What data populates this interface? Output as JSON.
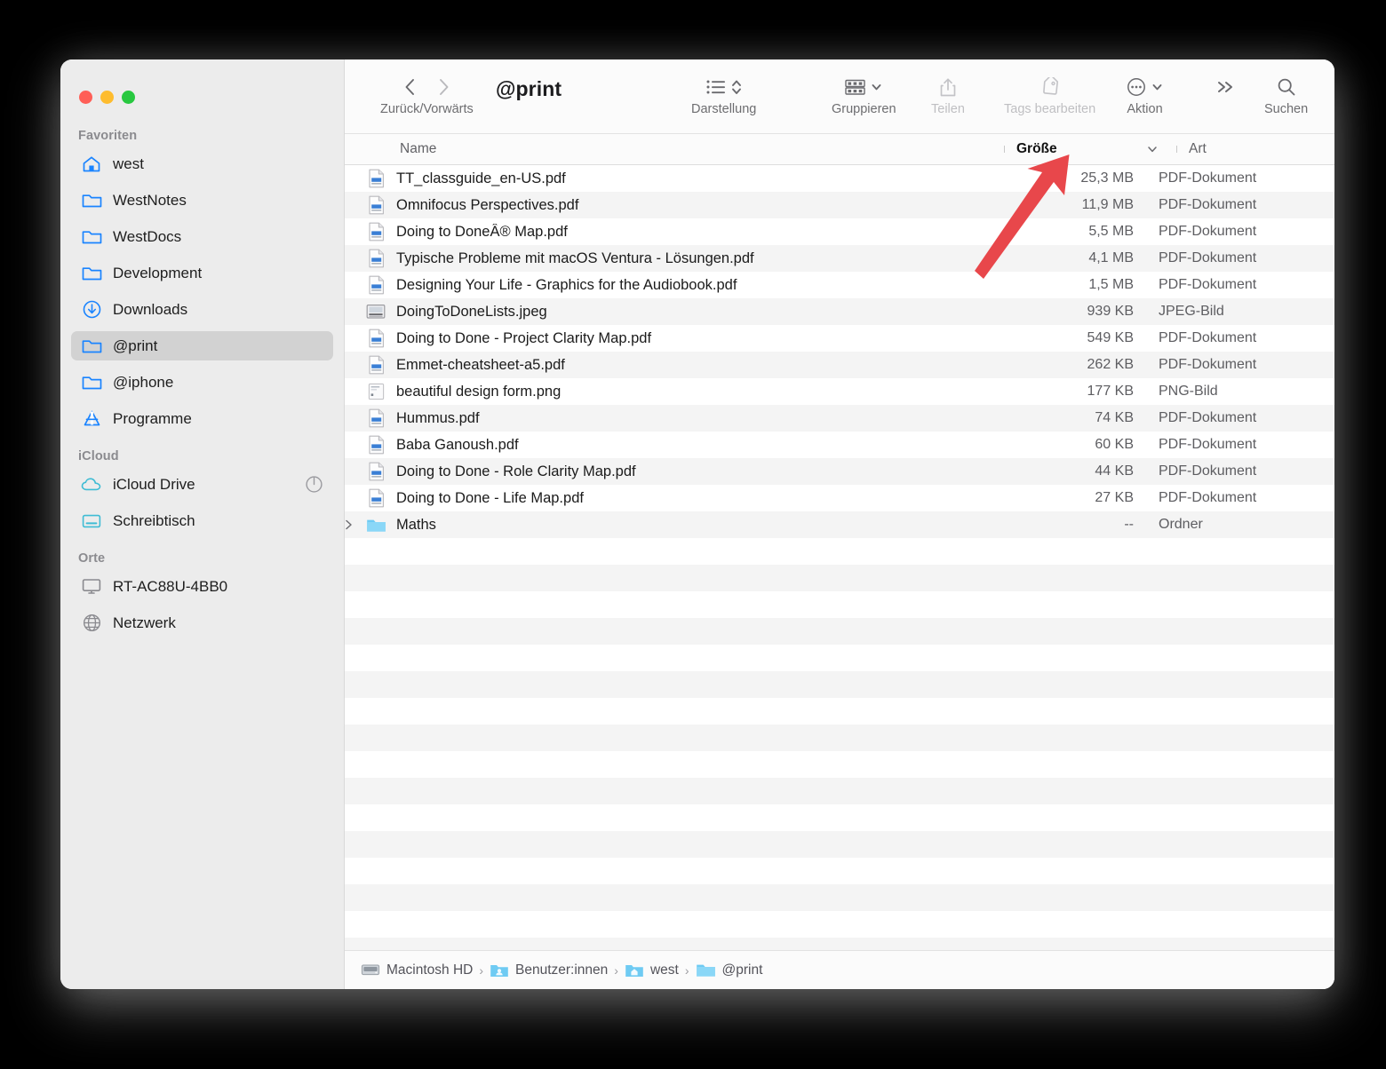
{
  "window": {
    "title": "@print",
    "traffic_lights": [
      "close",
      "minimize",
      "zoom"
    ]
  },
  "toolbar": {
    "nav_label": "Zurück/Vorwärts",
    "back_icon": "chevron-left-icon",
    "forward_icon": "chevron-right-icon",
    "title": "@print",
    "items": [
      {
        "label": "Darstellung",
        "icon": "list-view-icon",
        "enabled": true,
        "has_chevron": true
      },
      {
        "label": "Gruppieren",
        "icon": "group-icon",
        "enabled": true,
        "has_chevron": true
      },
      {
        "label": "Teilen",
        "icon": "share-icon",
        "enabled": false,
        "has_chevron": false
      },
      {
        "label": "Tags bearbeiten",
        "icon": "tag-icon",
        "enabled": false,
        "has_chevron": false
      },
      {
        "label": "Aktion",
        "icon": "more-circle-icon",
        "enabled": true,
        "has_chevron": true
      },
      {
        "label": "",
        "icon": "chevrons-right-icon",
        "enabled": true,
        "has_chevron": false
      },
      {
        "label": "Suchen",
        "icon": "search-icon",
        "enabled": true,
        "has_chevron": false
      }
    ]
  },
  "sidebar": {
    "groups": [
      {
        "title": "Favoriten",
        "items": [
          {
            "label": "west",
            "icon": "home-icon",
            "selected": false
          },
          {
            "label": "WestNotes",
            "icon": "folder-icon",
            "selected": false
          },
          {
            "label": "WestDocs",
            "icon": "folder-icon",
            "selected": false
          },
          {
            "label": "Development",
            "icon": "folder-icon",
            "selected": false
          },
          {
            "label": "Downloads",
            "icon": "download-circle-icon",
            "selected": false
          },
          {
            "label": "@print",
            "icon": "folder-icon",
            "selected": true
          },
          {
            "label": "@iphone",
            "icon": "folder-icon",
            "selected": false
          },
          {
            "label": "Programme",
            "icon": "applications-icon",
            "selected": false
          }
        ]
      },
      {
        "title": "iCloud",
        "items": [
          {
            "label": "iCloud Drive",
            "icon": "cloud-icon",
            "selected": false,
            "status_icon": "sync-progress-icon"
          },
          {
            "label": "Schreibtisch",
            "icon": "desktop-icon",
            "selected": false
          }
        ]
      },
      {
        "title": "Orte",
        "items": [
          {
            "label": "RT-AC88U-4BB0",
            "icon": "display-icon",
            "selected": false
          },
          {
            "label": "Netzwerk",
            "icon": "globe-icon",
            "selected": false
          }
        ]
      }
    ]
  },
  "columns": {
    "name": "Name",
    "size": "Größe",
    "kind": "Art",
    "sorted_by": "Größe",
    "sort_direction": "descending",
    "sort_icon": "chevron-down-icon"
  },
  "files": [
    {
      "name": "TT_classguide_en-US.pdf",
      "size": "25,3 MB",
      "kind": "PDF-Dokument",
      "icon": "pdf-file-icon",
      "is_folder": false
    },
    {
      "name": "Omnifocus Perspectives.pdf",
      "size": "11,9 MB",
      "kind": "PDF-Dokument",
      "icon": "pdf-file-icon",
      "is_folder": false
    },
    {
      "name": "Doing to DoneÂ® Map.pdf",
      "size": "5,5 MB",
      "kind": "PDF-Dokument",
      "icon": "pdf-file-icon",
      "is_folder": false
    },
    {
      "name": "Typische Probleme mit macOS Ventura - Lösungen.pdf",
      "size": "4,1 MB",
      "kind": "PDF-Dokument",
      "icon": "pdf-file-icon",
      "is_folder": false
    },
    {
      "name": "Designing Your Life - Graphics for the Audiobook.pdf",
      "size": "1,5 MB",
      "kind": "PDF-Dokument",
      "icon": "pdf-file-icon",
      "is_folder": false
    },
    {
      "name": "DoingToDoneLists.jpeg",
      "size": "939 KB",
      "kind": "JPEG-Bild",
      "icon": "jpeg-file-icon",
      "is_folder": false
    },
    {
      "name": "Doing to Done - Project Clarity Map.pdf",
      "size": "549 KB",
      "kind": "PDF-Dokument",
      "icon": "pdf-file-icon",
      "is_folder": false
    },
    {
      "name": "Emmet-cheatsheet-a5.pdf",
      "size": "262 KB",
      "kind": "PDF-Dokument",
      "icon": "pdf-file-icon",
      "is_folder": false
    },
    {
      "name": "beautiful design form.png",
      "size": "177 KB",
      "kind": "PNG-Bild",
      "icon": "png-file-icon",
      "is_folder": false
    },
    {
      "name": "Hummus.pdf",
      "size": "74 KB",
      "kind": "PDF-Dokument",
      "icon": "pdf-file-icon",
      "is_folder": false
    },
    {
      "name": "Baba Ganoush.pdf",
      "size": "60 KB",
      "kind": "PDF-Dokument",
      "icon": "pdf-file-icon",
      "is_folder": false
    },
    {
      "name": "Doing to Done - Role Clarity Map.pdf",
      "size": "44 KB",
      "kind": "PDF-Dokument",
      "icon": "pdf-file-icon",
      "is_folder": false
    },
    {
      "name": "Doing to Done - Life Map.pdf",
      "size": "27 KB",
      "kind": "PDF-Dokument",
      "icon": "pdf-file-icon",
      "is_folder": false
    },
    {
      "name": "Maths",
      "size": "--",
      "kind": "Ordner",
      "icon": "folder-icon",
      "is_folder": true
    }
  ],
  "path_bar": [
    {
      "label": "Macintosh HD",
      "icon": "harddisk-icon"
    },
    {
      "label": "Benutzer:innen",
      "icon": "users-folder-icon"
    },
    {
      "label": "west",
      "icon": "home-folder-icon"
    },
    {
      "label": "@print",
      "icon": "folder-icon"
    }
  ],
  "annotation": {
    "type": "arrow",
    "color": "#e8474b",
    "points_at": "Größe"
  },
  "colors": {
    "accent_blue": "#1a84ff",
    "folder_blue": "#5ac8f5",
    "sidebar_bg": "#ececec",
    "selection_bg": "#d2d2d2",
    "row_alt_bg": "#f4f4f4",
    "arrow_red": "#e8474b"
  }
}
